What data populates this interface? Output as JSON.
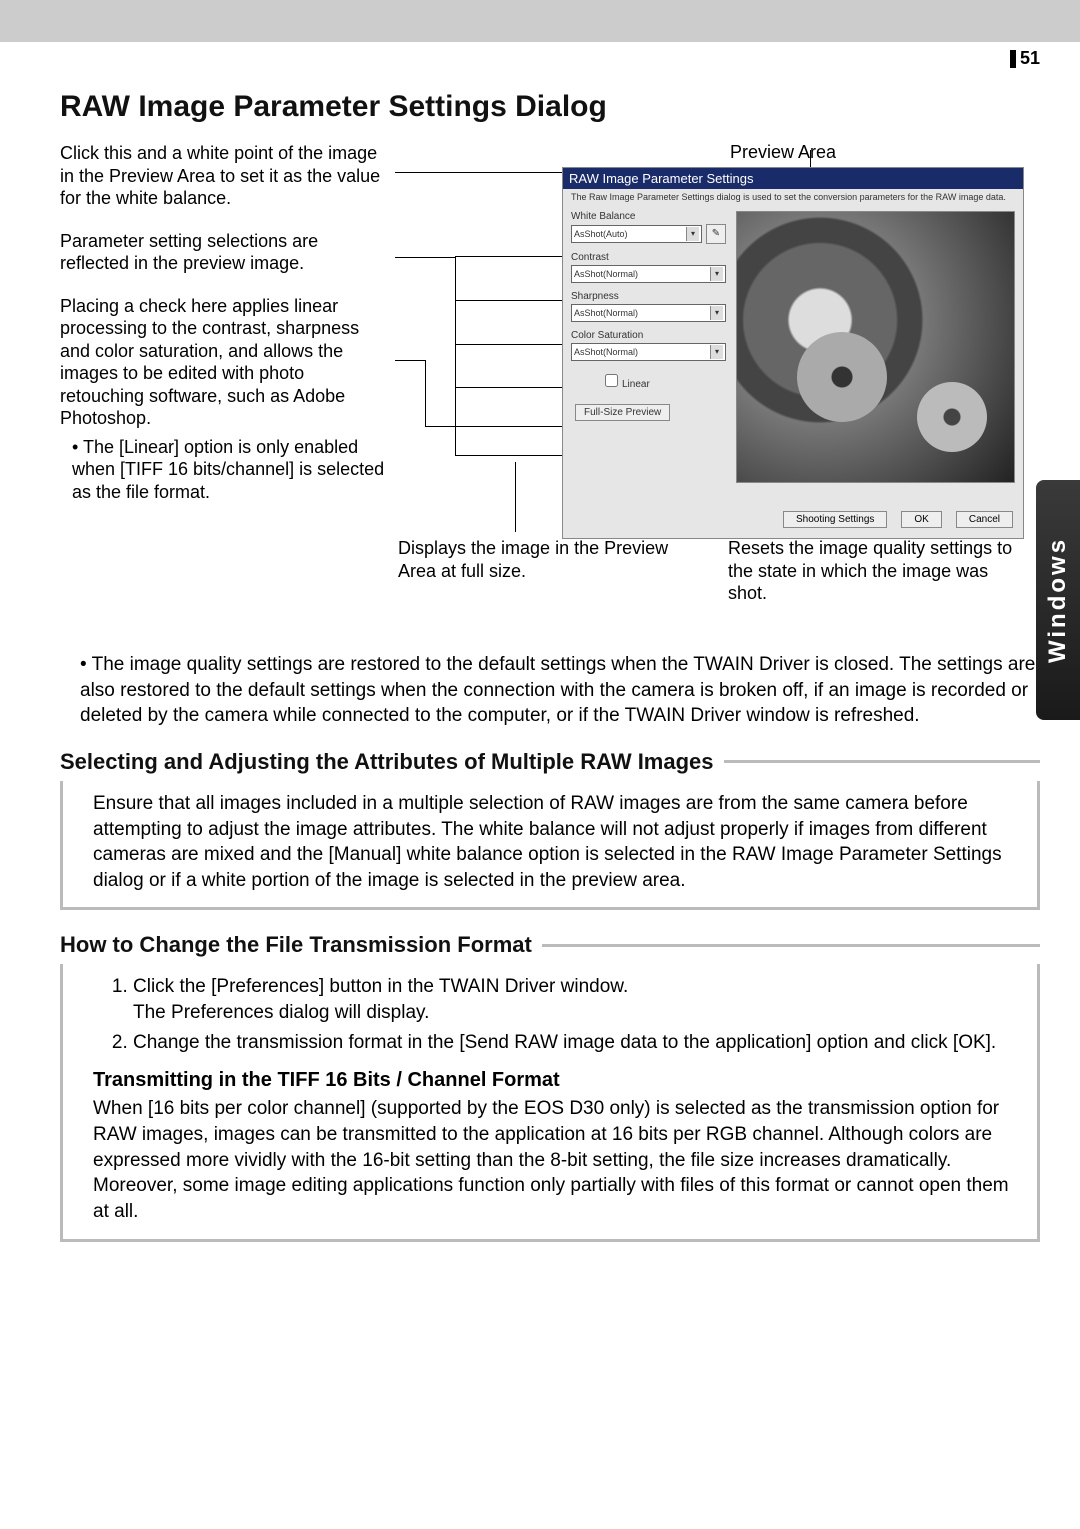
{
  "page_number": "51",
  "title": "RAW Image Parameter Settings Dialog",
  "side_tab": "Windows",
  "preview_area_label": "Preview Area",
  "notes": {
    "eyedropper": "Click this and a white point of the image in the Preview Area to set it as the value for the white balance.",
    "params": "Parameter setting selections are reflected in the preview image.",
    "linear": "Placing a check here applies linear processing to the contrast, sharpness and color saturation, and allows the images to be edited with photo retouching software, such as Adobe Photoshop.",
    "linear_sub": "The [Linear] option is only enabled when [TIFF 16 bits/channel] is selected as the file format.",
    "fullsize": "Displays the image in the Preview Area at full size.",
    "shooting": "Resets the image quality settings to the state in which the image was shot."
  },
  "dialog": {
    "title": "RAW Image Parameter Settings",
    "description": "The Raw Image Parameter Settings dialog is used to set the conversion parameters for the RAW image data.",
    "white_balance": {
      "label": "White Balance",
      "value": "AsShot(Auto)"
    },
    "contrast": {
      "label": "Contrast",
      "value": "AsShot(Normal)"
    },
    "sharpness": {
      "label": "Sharpness",
      "value": "AsShot(Normal)"
    },
    "color_sat": {
      "label": "Color Saturation",
      "value": "AsShot(Normal)"
    },
    "linear_label": "Linear",
    "fullsize_label": "Full-Size Preview",
    "shooting_btn": "Shooting Settings",
    "ok_btn": "OK",
    "cancel_btn": "Cancel"
  },
  "mid_bullet": "The image quality settings are restored to the default settings when the TWAIN Driver is closed. The settings are also restored to the default settings when the connection with the camera is broken off, if an image is recorded or deleted by the camera while connected to the computer, or if the TWAIN Driver window is refreshed.",
  "section_multi": {
    "heading": "Selecting and Adjusting the Attributes of Multiple RAW Images",
    "body": "Ensure that all images included in a multiple selection of RAW images are from the same camera before attempting to adjust the image attributes. The white balance will not adjust properly if images from different cameras are mixed and the [Manual] white balance option is selected in the RAW Image Parameter Settings dialog or if a white portion of the image is selected in the preview area."
  },
  "section_format": {
    "heading": "How to Change the File Transmission Format",
    "step1a": "Click the [Preferences] button in the TWAIN Driver window.",
    "step1b": "The Preferences dialog will display.",
    "step2": "Change the transmission format in the [Send RAW image data to the application] option and click [OK].",
    "sub_heading": "Transmitting in the TIFF 16 Bits / Channel Format",
    "sub_body": "When [16 bits per color channel] (supported by the EOS D30 only) is selected as the transmission option for RAW images, images can be transmitted to the application at 16 bits per RGB channel. Although colors are expressed more vividly with the 16-bit setting than the 8-bit setting, the file size increases dramatically. Moreover, some image editing applications function only partially with files of this format or cannot open them at all."
  }
}
